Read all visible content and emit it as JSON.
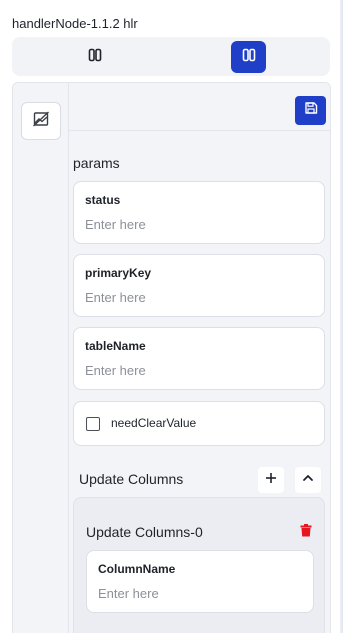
{
  "window": {
    "title": "handlerNode-1.1.2 hlr"
  },
  "toggle": {
    "left_icon": "split-columns-icon",
    "right_icon": "split-columns-icon",
    "active": "right",
    "accent_color": "#1f3fc9"
  },
  "sidebar": {
    "button_icon": "image-off-icon"
  },
  "toolbar": {
    "save_icon": "save-icon"
  },
  "params": {
    "section_label": "params",
    "fields": [
      {
        "label": "status",
        "value": "",
        "placeholder": "Enter here"
      },
      {
        "label": "primaryKey",
        "value": "",
        "placeholder": "Enter here"
      },
      {
        "label": "tableName",
        "value": "",
        "placeholder": "Enter here"
      }
    ],
    "checkbox": {
      "label": "needClearValue",
      "checked": false
    }
  },
  "update_columns": {
    "label": "Update Columns",
    "add_icon": "plus-icon",
    "collapse_icon": "chevron-up-icon",
    "items": [
      {
        "title": "Update Columns-0",
        "delete_icon": "trash-icon",
        "delete_color": "#e5161d",
        "field": {
          "label": "ColumnName",
          "value": "",
          "placeholder": "Enter here"
        }
      }
    ]
  }
}
